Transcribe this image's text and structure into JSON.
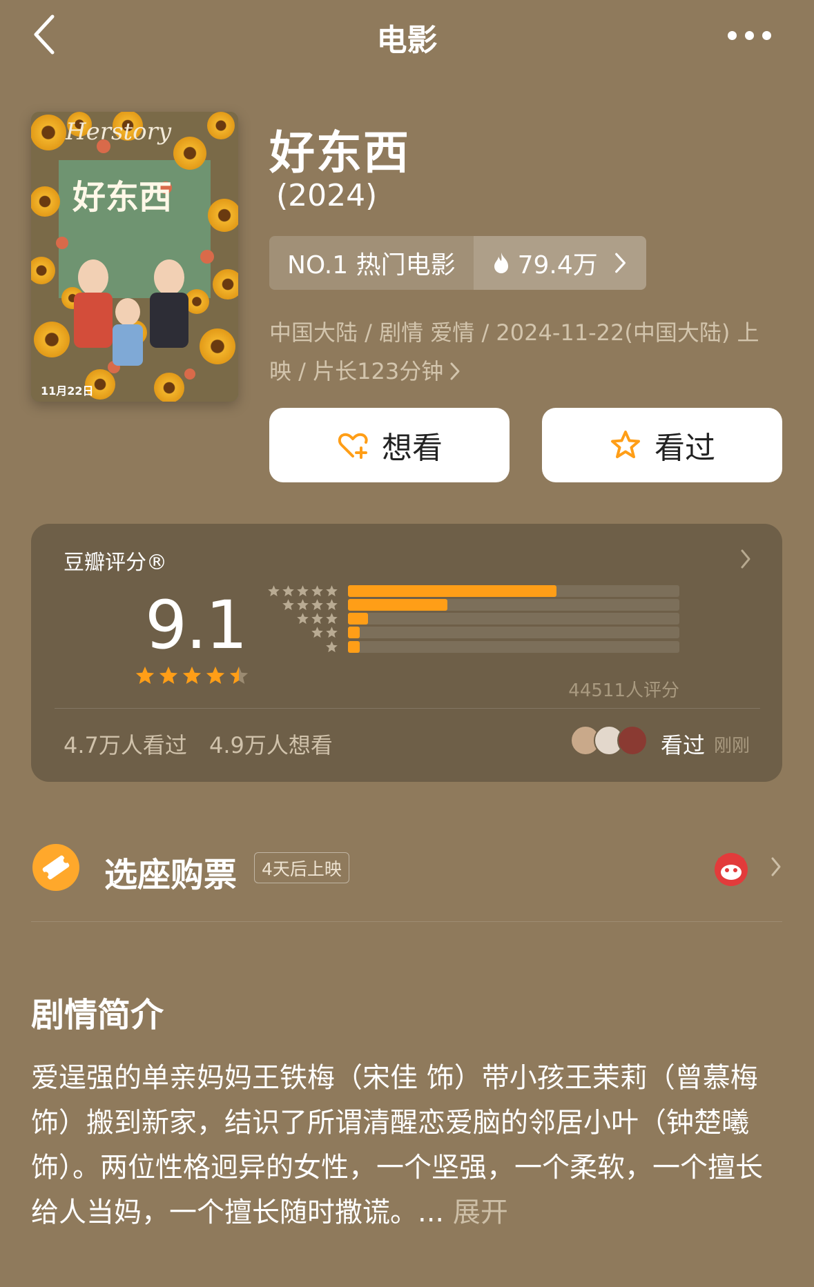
{
  "nav": {
    "title": "电影"
  },
  "poster": {
    "title_text": "Herstory",
    "cn_title": "好东西",
    "date_text": "11月22日"
  },
  "movie": {
    "title": "好东西",
    "year": "(2024)",
    "rank_label": "NO.1 热门电影",
    "heat_value": "79.4万",
    "meta_line1": "中国大陆 / 剧情 爱情 / 2024-11-22(中国大陆) 上",
    "meta_line2": "映 / 片长123分钟"
  },
  "actions": {
    "want_label": "想看",
    "seen_label": "看过"
  },
  "rating": {
    "label": "豆瓣评分®",
    "score": "9.1",
    "stars": 4.5,
    "distribution": [
      {
        "stars": 5,
        "fraction": 0.63
      },
      {
        "stars": 4,
        "fraction": 0.3
      },
      {
        "stars": 3,
        "fraction": 0.06
      },
      {
        "stars": 2,
        "fraction": 0.035
      },
      {
        "stars": 1,
        "fraction": 0.035
      }
    ],
    "count_text": "44511人评分",
    "seen_text": "4.7万人看过",
    "want_text": "4.9万人想看",
    "friend_action": "看过",
    "friend_time": "刚刚",
    "accent_color": "#ff9e17"
  },
  "ticket": {
    "title": "选座购票",
    "badge": "4天后上映"
  },
  "synopsis": {
    "heading": "剧情简介",
    "text": "爱逞强的单亲妈妈王铁梅（宋佳 饰）带小孩王茉莉（曾慕梅 饰）搬到新家，结识了所谓清醒恋爱脑的邻居小叶（钟楚曦 饰）。两位性格迥异的女性，一个坚强，一个柔软，一个擅长给人当妈，一个擅长随时撒谎。...",
    "more": " 展开"
  }
}
